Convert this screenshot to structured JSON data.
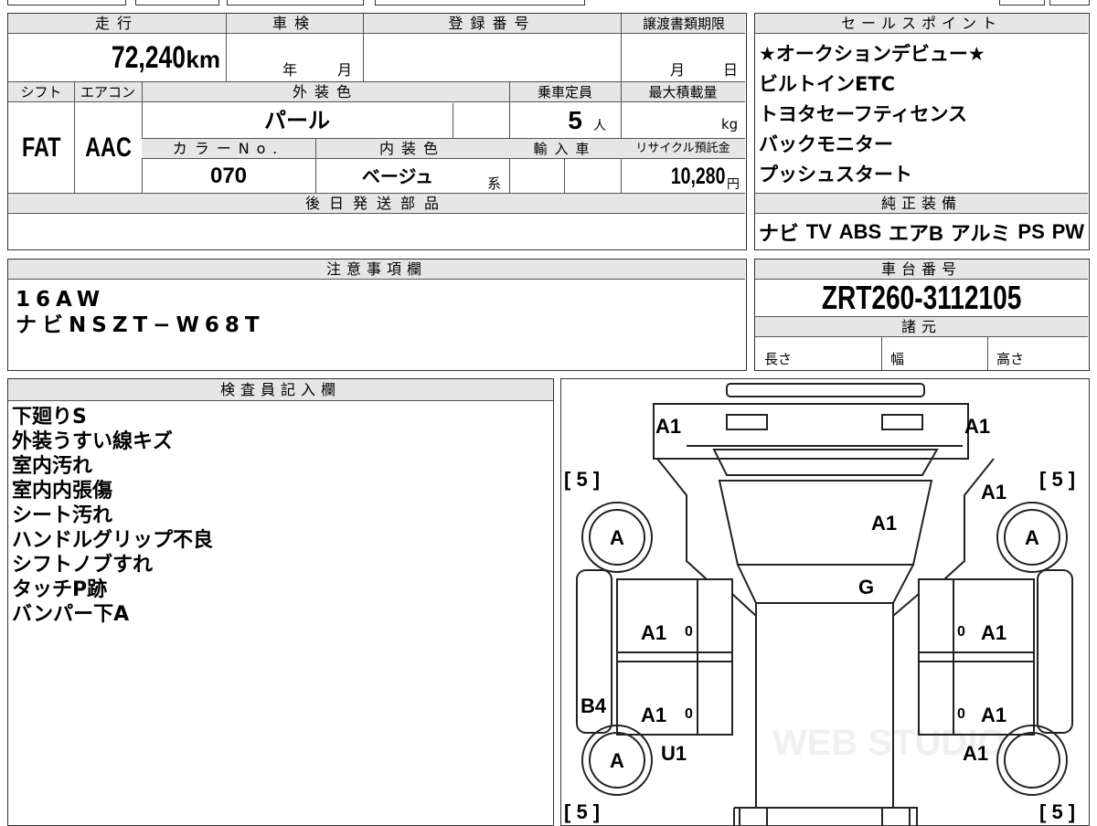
{
  "vehicle_box": {
    "mileage_label": "走行",
    "mileage_value": "72,240",
    "mileage_unit": "km",
    "inspection_label": "車検",
    "year_unit": "年",
    "month_unit": "月",
    "reg_label": "登録番号",
    "transfer_label": "譲渡書類期限",
    "month2": "月",
    "day": "日",
    "shift_label": "シフト",
    "ac_label": "エアコン",
    "color_label": "外装色",
    "capacity_label": "乗車定員",
    "maxload_label": "最大積載量",
    "shift_value": "FAT",
    "ac_value": "AAC",
    "color_value": "パール",
    "capacity_value": "5",
    "capacity_unit": "人",
    "maxload_unit": "kg",
    "colorno_label": "カラーNo.",
    "interior_label": "内装色",
    "import_label": "輸入車",
    "recycle_label": "リサイクル預託金",
    "colorno_value": "070",
    "interior_value": "ベージュ",
    "interior_suffix": "系",
    "recycle_value": "10,280",
    "recycle_unit": "円",
    "later_parts_label": "後日発送部品"
  },
  "sales_points": {
    "label": "セールスポイント",
    "items": [
      "★オークションデビュー★",
      "ビルトインETC",
      "トヨタセーフティセンス",
      "バックモニター",
      "プッシュスタート"
    ]
  },
  "genuine": {
    "label": "純正装備",
    "items": [
      "ナビ",
      "TV",
      "ABS",
      "エアB",
      "アルミ",
      "PS",
      "PW"
    ]
  },
  "notes": {
    "label": "注意事項欄",
    "lines": [
      "16AW",
      "ナビNSZT−W68T"
    ]
  },
  "chassis": {
    "label": "車台番号",
    "value": "ZRT260-3112105",
    "spec_label": "諸元",
    "length_label": "長さ",
    "width_label": "幅",
    "height_label": "高さ"
  },
  "inspector": {
    "label": "検査員記入欄",
    "lines": [
      "下廻りS",
      "外装うすい線キズ",
      "室内汚れ",
      "室内内張傷",
      "シート汚れ",
      "ハンドルグリップ不良",
      "シフトノブすれ",
      "タッチP跡",
      "バンパー下A"
    ]
  },
  "diagram": {
    "marks": {
      "front_left": "A1",
      "front_right": "A1",
      "hood": "A1",
      "right_front_fender": "A1",
      "windshield": "G",
      "left_front_door": "A1",
      "right_front_door": "A1",
      "left_rear_door": "A1",
      "right_rear_door": "A1",
      "left_sill": "B4",
      "left_rear_fender": "U1",
      "right_rear_fender": "A1",
      "wheel_fl": "A",
      "wheel_fr": "A",
      "wheel_rl": "A",
      "door_small_1": "0",
      "door_small_2": "0",
      "door_small_3": "0",
      "door_small_4": "0"
    },
    "tires": {
      "fl": "[ 5 ]",
      "fr": "[ 5 ]",
      "rl": "[ 5 ]",
      "rr": "[ 5 ]"
    },
    "watermark": "WEB STUDIO"
  }
}
